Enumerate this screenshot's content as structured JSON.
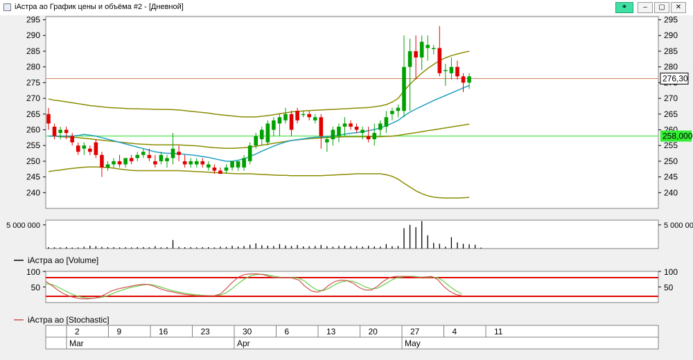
{
  "window": {
    "title": "iАстра ао График цены и объёма #2 - [Дневной]",
    "buttons": {
      "link": "⚭",
      "minimize": "–",
      "restore": "▢",
      "close": "✕"
    }
  },
  "colors": {
    "up": "#00a000",
    "down": "#e00000",
    "bollinger": "#8b8b00",
    "ma": "#1e9fc0",
    "last_price_line": "#d08060",
    "level_line": "#66e866",
    "stoch_band": "#e00000",
    "stoch_k": "#d05050",
    "stoch_d": "#66cc44"
  },
  "chart_data": {
    "type": "candlestick",
    "price": {
      "ylim": [
        235,
        296
      ],
      "yticks": [
        240,
        245,
        250,
        255,
        260,
        265,
        270,
        275,
        280,
        285,
        290,
        295
      ],
      "last_price_label": "276,30",
      "last_price": 276.3,
      "level_label": "258,000",
      "level": 258.0,
      "candles": [
        [
          265,
          267,
          260,
          262
        ],
        [
          261,
          262,
          257,
          258
        ],
        [
          259,
          261,
          257,
          260
        ],
        [
          260,
          261,
          257,
          259
        ],
        [
          258,
          259,
          255,
          256
        ],
        [
          255,
          256,
          252,
          253
        ],
        [
          254,
          256,
          252,
          255
        ],
        [
          254,
          255,
          252,
          253
        ],
        [
          256,
          257,
          251,
          252
        ],
        [
          252,
          253,
          245,
          248
        ],
        [
          248,
          250,
          247,
          249
        ],
        [
          249,
          251,
          248,
          250
        ],
        [
          250,
          252,
          248,
          249
        ],
        [
          249,
          251,
          248,
          251
        ],
        [
          251,
          252,
          249,
          250
        ],
        [
          251,
          253,
          250,
          252
        ],
        [
          252,
          254,
          251,
          253
        ],
        [
          252,
          254,
          250,
          251
        ],
        [
          250,
          252,
          248,
          249
        ],
        [
          250,
          253,
          249,
          252
        ],
        [
          250,
          252,
          248,
          251
        ],
        [
          251,
          259,
          249,
          254
        ],
        [
          253,
          255,
          250,
          252
        ],
        [
          250,
          252,
          248,
          249
        ],
        [
          249,
          251,
          248,
          250
        ],
        [
          249,
          251,
          248,
          250
        ],
        [
          250,
          251,
          248,
          249
        ],
        [
          248,
          250,
          247,
          249
        ],
        [
          248,
          249,
          246,
          247
        ],
        [
          247,
          248,
          246,
          246
        ],
        [
          247,
          249,
          246,
          248
        ],
        [
          248,
          250,
          247,
          250
        ],
        [
          248,
          250,
          247,
          250
        ],
        [
          248,
          252,
          247,
          251
        ],
        [
          250,
          256,
          249,
          255
        ],
        [
          255,
          259,
          254,
          258
        ],
        [
          257,
          261,
          255,
          260
        ],
        [
          256,
          263,
          255,
          262
        ],
        [
          260,
          264,
          258,
          263
        ],
        [
          262,
          265,
          258,
          264
        ],
        [
          263,
          267,
          262,
          265
        ],
        [
          265,
          266,
          258,
          260
        ],
        [
          266,
          267,
          262,
          263
        ],
        [
          265,
          266,
          264,
          265
        ],
        [
          265,
          266,
          263,
          264
        ],
        [
          263,
          265,
          262,
          264
        ],
        [
          264,
          265,
          254,
          258
        ],
        [
          256,
          258,
          253,
          257
        ],
        [
          257,
          261,
          255,
          260
        ],
        [
          258,
          262,
          256,
          261
        ],
        [
          261,
          264,
          258,
          262
        ],
        [
          262,
          263,
          260,
          261
        ],
        [
          261,
          262,
          259,
          260
        ],
        [
          259,
          261,
          257,
          260
        ],
        [
          258,
          261,
          256,
          257
        ],
        [
          257,
          262,
          255,
          259
        ],
        [
          260,
          263,
          258,
          262
        ],
        [
          261,
          266,
          259,
          264
        ],
        [
          265,
          267,
          263,
          266
        ],
        [
          266,
          268,
          264,
          267
        ],
        [
          266,
          290,
          264,
          280
        ],
        [
          280,
          289,
          266,
          285
        ],
        [
          285,
          290,
          276,
          283
        ],
        [
          283,
          290,
          279,
          288
        ],
        [
          286,
          290,
          282,
          287
        ],
        [
          286,
          287,
          284,
          286
        ],
        [
          286,
          293,
          277,
          278
        ],
        [
          279,
          281,
          274,
          279
        ],
        [
          278,
          283,
          276,
          280
        ],
        [
          280,
          282,
          276,
          277
        ],
        [
          277,
          278,
          272,
          275
        ],
        [
          275,
          278,
          273,
          277
        ]
      ],
      "ma": [
        258,
        258,
        258,
        258,
        258,
        258.2,
        258.5,
        258.3,
        258,
        257.5,
        257,
        256.5,
        256,
        255.5,
        255,
        254.5,
        254,
        253.5,
        253,
        252.7,
        252.5,
        252.5,
        252.4,
        252.2,
        252,
        251.8,
        251.5,
        251.2,
        250.8,
        250.4,
        250,
        250,
        250.3,
        250.8,
        251.5,
        252.3,
        253.2,
        254,
        254.8,
        255.5,
        256.1,
        256.6,
        256.9,
        257.1,
        257.4,
        257.6,
        257.7,
        257.8,
        258,
        258.3,
        258.6,
        258.9,
        259.1,
        259.4,
        259.7,
        260.1,
        260.6,
        261.3,
        262.1,
        263,
        264.4,
        265.6,
        266.6,
        267.5,
        268.4,
        269.3,
        270.1,
        270.9,
        271.7,
        272.5,
        273.3,
        274.1
      ],
      "bb_upper": [
        269.8,
        269.4,
        269.2,
        268.9,
        268.6,
        268.3,
        268,
        267.7,
        267.5,
        267.3,
        267.1,
        267,
        266.9,
        266.8,
        266.7,
        266.7,
        266.6,
        266.6,
        266.5,
        266.5,
        266.5,
        266.4,
        266.3,
        266.1,
        265.9,
        265.7,
        265.5,
        265.3,
        265,
        264.8,
        264.6,
        264.4,
        264.2,
        264.1,
        264.1,
        264.1,
        264.3,
        264.5,
        264.8,
        265.1,
        265.4,
        265.7,
        265.9,
        266,
        266.1,
        266.2,
        266.3,
        266.4,
        266.5,
        266.6,
        266.7,
        266.8,
        266.9,
        267,
        267.1,
        267.3,
        267.6,
        268,
        268.8,
        270,
        272.4,
        274.5,
        276.3,
        278,
        279.5,
        280.8,
        282,
        282.9,
        283.6,
        284.1,
        284.6,
        285
      ],
      "bb_middle": [
        258,
        258,
        257.8,
        257.7,
        257.6,
        257.5,
        257.3,
        257.1,
        256.9,
        256.7,
        256.5,
        256.3,
        256.1,
        255.9,
        255.7,
        255.5,
        255.4,
        255.3,
        255.2,
        255.2,
        255.2,
        255.2,
        255.2,
        255.1,
        255,
        254.9,
        254.7,
        254.5,
        254.3,
        254.2,
        254.1,
        254.1,
        254.2,
        254.3,
        254.5,
        254.8,
        255.1,
        255.4,
        255.7,
        256,
        256.3,
        256.6,
        256.8,
        257,
        257.2,
        257.3,
        257.4,
        257.5,
        257.6,
        257.7,
        257.8,
        257.8,
        257.8,
        257.8,
        257.8,
        257.8,
        257.8,
        257.9,
        258,
        258.2,
        258.5,
        258.8,
        259.1,
        259.4,
        259.7,
        260,
        260.3,
        260.6,
        260.9,
        261.2,
        261.5,
        261.8
      ],
      "bb_lower": [
        246.7,
        247,
        247.2,
        247.5,
        247.7,
        247.9,
        248.1,
        248.2,
        248.2,
        248.1,
        248,
        247.8,
        247.5,
        247.3,
        247.1,
        247,
        247,
        247,
        247,
        247,
        247,
        247,
        247,
        246.9,
        246.8,
        246.7,
        246.6,
        246.5,
        246.4,
        246.3,
        246.2,
        246.1,
        246,
        246,
        246,
        245.9,
        245.8,
        245.7,
        245.6,
        245.5,
        245.5,
        245.4,
        245.4,
        245.4,
        245.4,
        245.4,
        245.4,
        245.5,
        245.6,
        245.7,
        245.8,
        245.9,
        246,
        246,
        246,
        246,
        246,
        245.7,
        245.2,
        244.3,
        243,
        241.8,
        240.6,
        239.7,
        239,
        238.6,
        238.4,
        238.3,
        238.3,
        238.3,
        238.4,
        238.5
      ]
    },
    "volume": {
      "label": "iАстра ао [Volume]",
      "tick_label": "5 000 000",
      "tick_value": 5000000,
      "ylim": [
        0,
        6000000
      ],
      "values": [
        300000,
        280000,
        250000,
        320000,
        220000,
        250000,
        380000,
        600000,
        500000,
        350000,
        300000,
        300000,
        250000,
        280000,
        240000,
        320000,
        300000,
        280000,
        500000,
        250000,
        300000,
        1800000,
        350000,
        280000,
        300000,
        250000,
        280000,
        300000,
        250000,
        400000,
        350000,
        600000,
        450000,
        550000,
        800000,
        1100000,
        700000,
        600000,
        550000,
        950000,
        650000,
        550000,
        750000,
        450000,
        480000,
        550000,
        750000,
        500000,
        400000,
        550000,
        600000,
        450000,
        500000,
        400000,
        600000,
        450000,
        400000,
        950000,
        500000,
        550000,
        4300000,
        5000000,
        4500000,
        5800000,
        2800000,
        1200000,
        1000000,
        400000,
        2400000,
        1300000,
        1000000,
        900000,
        800000,
        200000
      ]
    },
    "stochastic": {
      "label": "iАстра ао [Stochastic]",
      "ylim": [
        0,
        100
      ],
      "yticks": [
        50,
        100
      ],
      "bands": [
        80,
        20
      ],
      "k": [
        68,
        55,
        40,
        28,
        20,
        15,
        12,
        12,
        14,
        18,
        28,
        38,
        44,
        48,
        52,
        56,
        58,
        58,
        52,
        44,
        38,
        34,
        30,
        26,
        24,
        22,
        22,
        22,
        22,
        28,
        46,
        66,
        82,
        90,
        92,
        92,
        90,
        84,
        80,
        80,
        80,
        78,
        72,
        52,
        38,
        33,
        40,
        56,
        68,
        72,
        70,
        62,
        48,
        40,
        40,
        52,
        68,
        80,
        84,
        84,
        84,
        82,
        80,
        82,
        84,
        74,
        52,
        36,
        26,
        22
      ],
      "d": [
        60,
        58,
        50,
        40,
        30,
        22,
        17,
        14,
        14,
        16,
        20,
        28,
        36,
        42,
        48,
        52,
        56,
        58,
        56,
        50,
        44,
        38,
        34,
        30,
        27,
        25,
        23,
        22,
        22,
        24,
        32,
        46,
        62,
        76,
        86,
        90,
        91,
        88,
        84,
        81,
        80,
        80,
        78,
        68,
        52,
        40,
        38,
        46,
        58,
        66,
        70,
        68,
        60,
        50,
        44,
        46,
        56,
        68,
        78,
        82,
        84,
        84,
        82,
        81,
        82,
        80,
        68,
        52,
        38,
        28
      ]
    },
    "time_axis": {
      "days": [
        {
          "label": "2",
          "idx": 2.5
        },
        {
          "label": "9",
          "idx": 7.5
        },
        {
          "label": "16",
          "idx": 12.5
        },
        {
          "label": "23",
          "idx": 17.5
        },
        {
          "label": "30",
          "idx": 22.5
        },
        {
          "label": "6",
          "idx": 27.5
        },
        {
          "label": "13",
          "idx": 32.5
        },
        {
          "label": "20",
          "idx": 37.5
        },
        {
          "label": "27",
          "idx": 42.5
        },
        {
          "label": "4",
          "idx": 47.5
        },
        {
          "label": "11",
          "idx": 52.5
        }
      ],
      "months": [
        {
          "label": "Mar",
          "idx": 2.5
        },
        {
          "label": "Apr",
          "idx": 22.5
        },
        {
          "label": "May",
          "idx": 42.5
        }
      ]
    }
  }
}
